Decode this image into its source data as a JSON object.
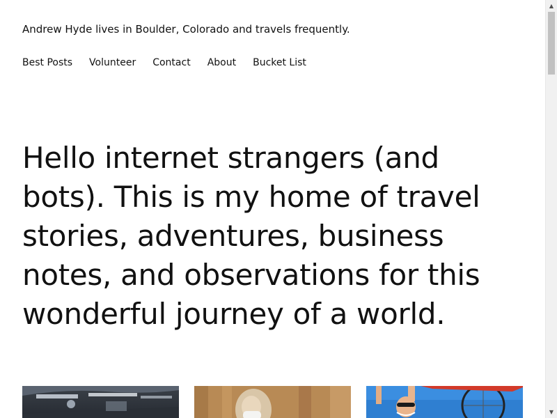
{
  "header": {
    "tagline": "Andrew Hyde lives in Boulder, Colorado and travels frequently."
  },
  "nav": {
    "items": [
      {
        "label": "Best Posts"
      },
      {
        "label": "Volunteer"
      },
      {
        "label": "Contact"
      },
      {
        "label": "About"
      },
      {
        "label": "Bucket List"
      }
    ]
  },
  "hero": {
    "text": "Hello internet strangers (and bots). This is my home of travel stories, adventures, business notes, and observations for this wonderful journey of a world."
  },
  "cards": [
    {
      "image": "airport-interior-photo"
    },
    {
      "image": "person-with-mask-photo"
    },
    {
      "image": "person-lifting-bicycle-photo"
    }
  ],
  "colors": {
    "text": "#111111",
    "background": "#ffffff",
    "scrollbar_track": "#f1f1f1",
    "scrollbar_thumb": "#c1c1c1"
  },
  "scrollbar": {
    "up_icon": "▲",
    "down_icon": "▼"
  }
}
